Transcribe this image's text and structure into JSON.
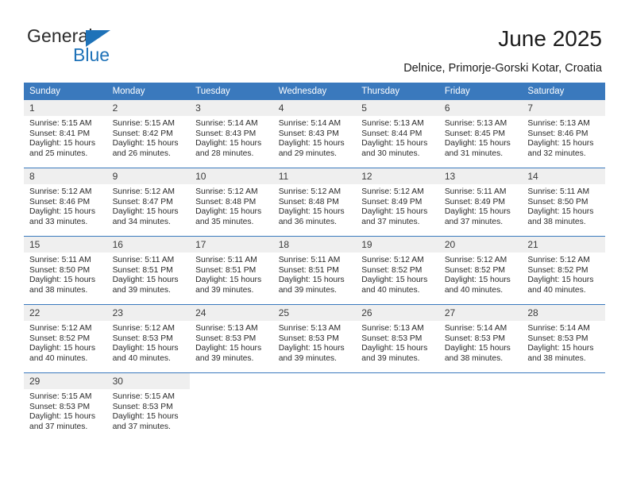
{
  "logo": {
    "primary_text": "General",
    "secondary_text": "Blue",
    "triangle_icon": "triangle-icon",
    "primary_color": "#2b2b2b",
    "secondary_color": "#1e72b8"
  },
  "header": {
    "title": "June 2025",
    "subtitle": "Delnice, Primorje-Gorski Kotar, Croatia"
  },
  "theme": {
    "header_row_bg": "#3a79bd",
    "header_row_text": "#ffffff",
    "daynum_bg": "#efefef",
    "row_divider": "#3a79bd",
    "body_text": "#2a2a2a"
  },
  "calendar": {
    "weekday_headers": [
      "Sunday",
      "Monday",
      "Tuesday",
      "Wednesday",
      "Thursday",
      "Friday",
      "Saturday"
    ],
    "weeks": [
      [
        {
          "day": "1",
          "sunrise": "Sunrise: 5:15 AM",
          "sunset": "Sunset: 8:41 PM",
          "daylight": "Daylight: 15 hours and 25 minutes."
        },
        {
          "day": "2",
          "sunrise": "Sunrise: 5:15 AM",
          "sunset": "Sunset: 8:42 PM",
          "daylight": "Daylight: 15 hours and 26 minutes."
        },
        {
          "day": "3",
          "sunrise": "Sunrise: 5:14 AM",
          "sunset": "Sunset: 8:43 PM",
          "daylight": "Daylight: 15 hours and 28 minutes."
        },
        {
          "day": "4",
          "sunrise": "Sunrise: 5:14 AM",
          "sunset": "Sunset: 8:43 PM",
          "daylight": "Daylight: 15 hours and 29 minutes."
        },
        {
          "day": "5",
          "sunrise": "Sunrise: 5:13 AM",
          "sunset": "Sunset: 8:44 PM",
          "daylight": "Daylight: 15 hours and 30 minutes."
        },
        {
          "day": "6",
          "sunrise": "Sunrise: 5:13 AM",
          "sunset": "Sunset: 8:45 PM",
          "daylight": "Daylight: 15 hours and 31 minutes."
        },
        {
          "day": "7",
          "sunrise": "Sunrise: 5:13 AM",
          "sunset": "Sunset: 8:46 PM",
          "daylight": "Daylight: 15 hours and 32 minutes."
        }
      ],
      [
        {
          "day": "8",
          "sunrise": "Sunrise: 5:12 AM",
          "sunset": "Sunset: 8:46 PM",
          "daylight": "Daylight: 15 hours and 33 minutes."
        },
        {
          "day": "9",
          "sunrise": "Sunrise: 5:12 AM",
          "sunset": "Sunset: 8:47 PM",
          "daylight": "Daylight: 15 hours and 34 minutes."
        },
        {
          "day": "10",
          "sunrise": "Sunrise: 5:12 AM",
          "sunset": "Sunset: 8:48 PM",
          "daylight": "Daylight: 15 hours and 35 minutes."
        },
        {
          "day": "11",
          "sunrise": "Sunrise: 5:12 AM",
          "sunset": "Sunset: 8:48 PM",
          "daylight": "Daylight: 15 hours and 36 minutes."
        },
        {
          "day": "12",
          "sunrise": "Sunrise: 5:12 AM",
          "sunset": "Sunset: 8:49 PM",
          "daylight": "Daylight: 15 hours and 37 minutes."
        },
        {
          "day": "13",
          "sunrise": "Sunrise: 5:11 AM",
          "sunset": "Sunset: 8:49 PM",
          "daylight": "Daylight: 15 hours and 37 minutes."
        },
        {
          "day": "14",
          "sunrise": "Sunrise: 5:11 AM",
          "sunset": "Sunset: 8:50 PM",
          "daylight": "Daylight: 15 hours and 38 minutes."
        }
      ],
      [
        {
          "day": "15",
          "sunrise": "Sunrise: 5:11 AM",
          "sunset": "Sunset: 8:50 PM",
          "daylight": "Daylight: 15 hours and 38 minutes."
        },
        {
          "day": "16",
          "sunrise": "Sunrise: 5:11 AM",
          "sunset": "Sunset: 8:51 PM",
          "daylight": "Daylight: 15 hours and 39 minutes."
        },
        {
          "day": "17",
          "sunrise": "Sunrise: 5:11 AM",
          "sunset": "Sunset: 8:51 PM",
          "daylight": "Daylight: 15 hours and 39 minutes."
        },
        {
          "day": "18",
          "sunrise": "Sunrise: 5:11 AM",
          "sunset": "Sunset: 8:51 PM",
          "daylight": "Daylight: 15 hours and 39 minutes."
        },
        {
          "day": "19",
          "sunrise": "Sunrise: 5:12 AM",
          "sunset": "Sunset: 8:52 PM",
          "daylight": "Daylight: 15 hours and 40 minutes."
        },
        {
          "day": "20",
          "sunrise": "Sunrise: 5:12 AM",
          "sunset": "Sunset: 8:52 PM",
          "daylight": "Daylight: 15 hours and 40 minutes."
        },
        {
          "day": "21",
          "sunrise": "Sunrise: 5:12 AM",
          "sunset": "Sunset: 8:52 PM",
          "daylight": "Daylight: 15 hours and 40 minutes."
        }
      ],
      [
        {
          "day": "22",
          "sunrise": "Sunrise: 5:12 AM",
          "sunset": "Sunset: 8:52 PM",
          "daylight": "Daylight: 15 hours and 40 minutes."
        },
        {
          "day": "23",
          "sunrise": "Sunrise: 5:12 AM",
          "sunset": "Sunset: 8:53 PM",
          "daylight": "Daylight: 15 hours and 40 minutes."
        },
        {
          "day": "24",
          "sunrise": "Sunrise: 5:13 AM",
          "sunset": "Sunset: 8:53 PM",
          "daylight": "Daylight: 15 hours and 39 minutes."
        },
        {
          "day": "25",
          "sunrise": "Sunrise: 5:13 AM",
          "sunset": "Sunset: 8:53 PM",
          "daylight": "Daylight: 15 hours and 39 minutes."
        },
        {
          "day": "26",
          "sunrise": "Sunrise: 5:13 AM",
          "sunset": "Sunset: 8:53 PM",
          "daylight": "Daylight: 15 hours and 39 minutes."
        },
        {
          "day": "27",
          "sunrise": "Sunrise: 5:14 AM",
          "sunset": "Sunset: 8:53 PM",
          "daylight": "Daylight: 15 hours and 38 minutes."
        },
        {
          "day": "28",
          "sunrise": "Sunrise: 5:14 AM",
          "sunset": "Sunset: 8:53 PM",
          "daylight": "Daylight: 15 hours and 38 minutes."
        }
      ],
      [
        {
          "day": "29",
          "sunrise": "Sunrise: 5:15 AM",
          "sunset": "Sunset: 8:53 PM",
          "daylight": "Daylight: 15 hours and 37 minutes."
        },
        {
          "day": "30",
          "sunrise": "Sunrise: 5:15 AM",
          "sunset": "Sunset: 8:53 PM",
          "daylight": "Daylight: 15 hours and 37 minutes."
        },
        {
          "day": "",
          "sunrise": "",
          "sunset": "",
          "daylight": ""
        },
        {
          "day": "",
          "sunrise": "",
          "sunset": "",
          "daylight": ""
        },
        {
          "day": "",
          "sunrise": "",
          "sunset": "",
          "daylight": ""
        },
        {
          "day": "",
          "sunrise": "",
          "sunset": "",
          "daylight": ""
        },
        {
          "day": "",
          "sunrise": "",
          "sunset": "",
          "daylight": ""
        }
      ]
    ]
  }
}
